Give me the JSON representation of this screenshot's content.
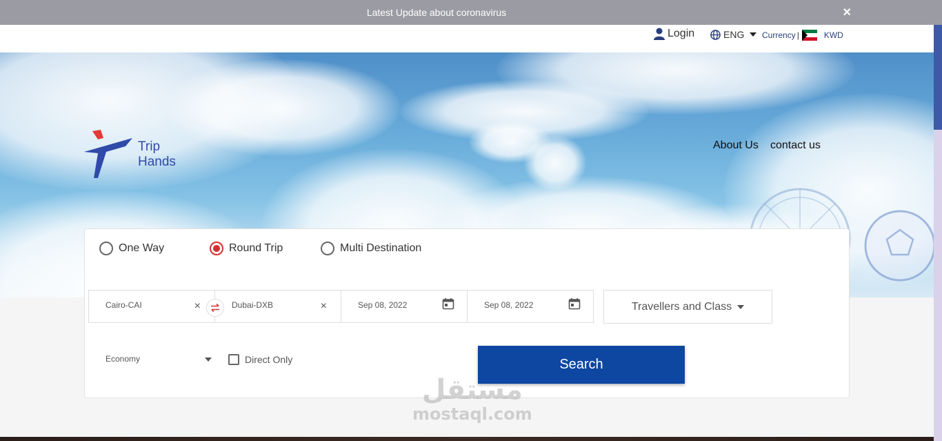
{
  "banner": {
    "text": "Latest Update about coronavirus",
    "close": "×"
  },
  "topbar": {
    "login": "Login",
    "language": "ENG",
    "currency_label": "Currency",
    "currency_sep": "|",
    "currency_code": "KWD"
  },
  "logo": {
    "line1": "Trip",
    "line2": "Hands"
  },
  "nav": {
    "about": "About Us",
    "contact": "contact us"
  },
  "trip_types": {
    "one_way": "One Way",
    "round_trip": "Round Trip",
    "multi": "Multi Destination",
    "selected": "Round Trip"
  },
  "search": {
    "from": "Cairo-CAI",
    "to": "Dubai-DXB",
    "depart": "Sep 08, 2022",
    "return": "Sep 08, 2022",
    "travellers": "Travellers and Class",
    "cabin": "Economy",
    "direct_only": "Direct Only",
    "button": "Search",
    "clear": "×"
  },
  "watermark": {
    "arabic": "مستقل",
    "latin": "mostaql.com"
  },
  "colors": {
    "accent": "#0d47a1",
    "radio_selected": "#d32f2f",
    "brand": "#2f4aa8",
    "logo_red": "#e53935"
  },
  "icons": {
    "login": "user-icon",
    "language": "globe-icon",
    "flag": "kuwait-flag-icon",
    "calendar": "calendar-icon",
    "swap": "swap-arrows-icon"
  }
}
